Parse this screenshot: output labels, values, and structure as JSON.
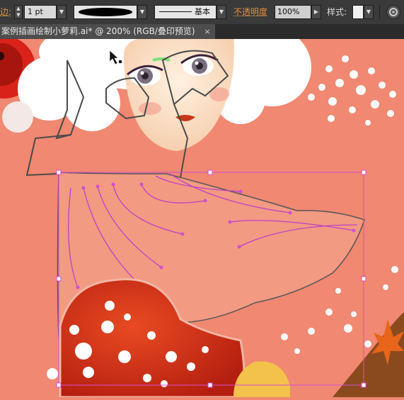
{
  "toolbar": {
    "stroke_label": "边:",
    "stroke_weight": "1 pt",
    "profile_label": "基本",
    "opacity_label": "不透明度",
    "opacity_value": "100%",
    "style_label": "样式:",
    "colors": {
      "panel": "#3a3a3a",
      "accent": "#e0903a"
    }
  },
  "document_tab": {
    "title": "案例插画绘制小萝莉.ai* @ 200% (RGB/叠印预览)",
    "close_label": "×"
  },
  "artwork": {
    "colors": {
      "background": "#f08872",
      "hair": "#ffffff",
      "skin": "#fde2c8",
      "mushroom": "#d83a1e",
      "selection": "#e055d8",
      "ground": "#8a4a1e",
      "leaf": "#e8651a"
    },
    "selection_handles": 16
  }
}
